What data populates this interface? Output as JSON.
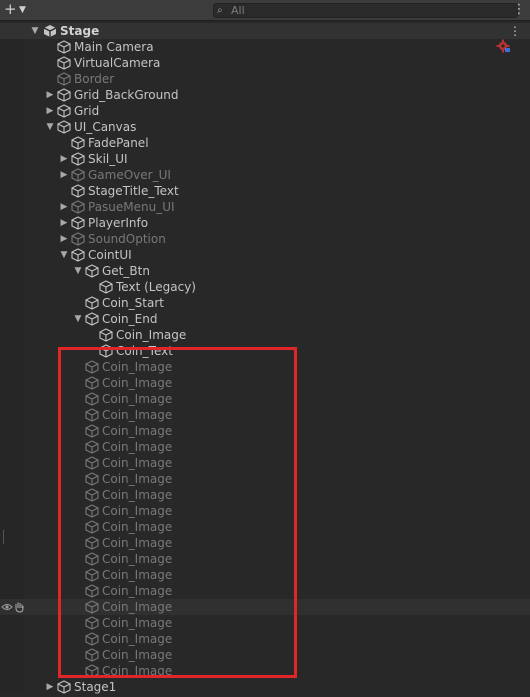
{
  "toolbar": {
    "add_icon": "plus-icon",
    "search_placeholder": "All",
    "search_icon": "search-icon",
    "more_icon": "kebab-menu-icon"
  },
  "scene": {
    "name": "Stage",
    "icon": "unity-scene-icon",
    "menu_icon": "kebab-menu-icon"
  },
  "items": [
    {
      "label": "Main Camera",
      "depth": 1,
      "arrow": "none",
      "dim": false
    },
    {
      "label": "VirtualCamera",
      "depth": 1,
      "arrow": "none",
      "dim": false
    },
    {
      "label": "Border",
      "depth": 1,
      "arrow": "none",
      "dim": true
    },
    {
      "label": "Grid_BackGround",
      "depth": 1,
      "arrow": "collapsed",
      "dim": false
    },
    {
      "label": "Grid",
      "depth": 1,
      "arrow": "collapsed",
      "dim": false
    },
    {
      "label": "UI_Canvas",
      "depth": 1,
      "arrow": "expanded",
      "dim": false
    },
    {
      "label": "FadePanel",
      "depth": 2,
      "arrow": "none",
      "dim": false
    },
    {
      "label": "Skil_UI",
      "depth": 2,
      "arrow": "collapsed",
      "dim": false
    },
    {
      "label": "GameOver_UI",
      "depth": 2,
      "arrow": "collapsed",
      "dim": true
    },
    {
      "label": "StageTitle_Text",
      "depth": 2,
      "arrow": "none",
      "dim": false
    },
    {
      "label": "PasueMenu_UI",
      "depth": 2,
      "arrow": "collapsed",
      "dim": true
    },
    {
      "label": "PlayerInfo",
      "depth": 2,
      "arrow": "collapsed",
      "dim": false
    },
    {
      "label": "SoundOption",
      "depth": 2,
      "arrow": "collapsed",
      "dim": true
    },
    {
      "label": "CointUI",
      "depth": 2,
      "arrow": "expanded",
      "dim": false
    },
    {
      "label": "Get_Btn",
      "depth": 3,
      "arrow": "expanded",
      "dim": false
    },
    {
      "label": "Text (Legacy)",
      "depth": 4,
      "arrow": "none",
      "dim": false
    },
    {
      "label": "Coin_Start",
      "depth": 3,
      "arrow": "none",
      "dim": false
    },
    {
      "label": "Coin_End",
      "depth": 3,
      "arrow": "expanded",
      "dim": false
    },
    {
      "label": "Coin_Image",
      "depth": 4,
      "arrow": "none",
      "dim": false
    },
    {
      "label": "Coin_Text",
      "depth": 4,
      "arrow": "none",
      "dim": false
    },
    {
      "label": "Coin_Image",
      "depth": 3,
      "arrow": "none",
      "dim": true
    },
    {
      "label": "Coin_Image",
      "depth": 3,
      "arrow": "none",
      "dim": true
    },
    {
      "label": "Coin_Image",
      "depth": 3,
      "arrow": "none",
      "dim": true
    },
    {
      "label": "Coin_Image",
      "depth": 3,
      "arrow": "none",
      "dim": true
    },
    {
      "label": "Coin_Image",
      "depth": 3,
      "arrow": "none",
      "dim": true
    },
    {
      "label": "Coin_Image",
      "depth": 3,
      "arrow": "none",
      "dim": true
    },
    {
      "label": "Coin_Image",
      "depth": 3,
      "arrow": "none",
      "dim": true
    },
    {
      "label": "Coin_Image",
      "depth": 3,
      "arrow": "none",
      "dim": true
    },
    {
      "label": "Coin_Image",
      "depth": 3,
      "arrow": "none",
      "dim": true
    },
    {
      "label": "Coin_Image",
      "depth": 3,
      "arrow": "none",
      "dim": true
    },
    {
      "label": "Coin_Image",
      "depth": 3,
      "arrow": "none",
      "dim": true
    },
    {
      "label": "Coin_Image",
      "depth": 3,
      "arrow": "none",
      "dim": true
    },
    {
      "label": "Coin_Image",
      "depth": 3,
      "arrow": "none",
      "dim": true
    },
    {
      "label": "Coin_Image",
      "depth": 3,
      "arrow": "none",
      "dim": true
    },
    {
      "label": "Coin_Image",
      "depth": 3,
      "arrow": "none",
      "dim": true
    },
    {
      "label": "Coin_Image",
      "depth": 3,
      "arrow": "none",
      "dim": true
    },
    {
      "label": "Coin_Image",
      "depth": 3,
      "arrow": "none",
      "dim": true
    },
    {
      "label": "Coin_Image",
      "depth": 3,
      "arrow": "none",
      "dim": true
    },
    {
      "label": "Coin_Image",
      "depth": 3,
      "arrow": "none",
      "dim": true
    },
    {
      "label": "Coin_Image",
      "depth": 3,
      "arrow": "none",
      "dim": true
    },
    {
      "label": "Stage1",
      "depth": 1,
      "arrow": "collapsed",
      "dim": false
    }
  ],
  "hovered_item_index": 35,
  "hover_icons": [
    "eye-icon",
    "hand-icon"
  ],
  "colors": {
    "background": "#282828",
    "toolbar": "#3c3c3c",
    "text": "#c4c4c4",
    "text_inactive": "#787878",
    "highlight_box": "#e1262a"
  }
}
